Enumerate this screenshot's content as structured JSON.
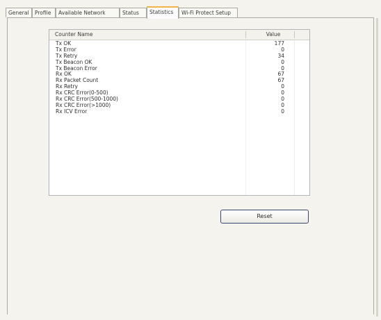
{
  "tabs": [
    {
      "label": "General"
    },
    {
      "label": "Profile"
    },
    {
      "label": "Available Network"
    },
    {
      "label": "Status"
    },
    {
      "label": "Statistics"
    },
    {
      "label": "Wi-Fi Protect Setup"
    }
  ],
  "active_tab": "Statistics",
  "statistics": {
    "columns": {
      "name": "Counter Name",
      "value": "Value"
    },
    "rows": [
      {
        "name": "Tx OK",
        "value": "177"
      },
      {
        "name": "Tx Error",
        "value": "0"
      },
      {
        "name": "Tx Retry",
        "value": "34"
      },
      {
        "name": "Tx Beacon OK",
        "value": "0"
      },
      {
        "name": "Tx Beacon Error",
        "value": "0"
      },
      {
        "name": "Rx OK",
        "value": "67"
      },
      {
        "name": "Rx Packet Count",
        "value": "67"
      },
      {
        "name": "Rx Retry",
        "value": "0"
      },
      {
        "name": "Rx CRC Error(0-500)",
        "value": "0"
      },
      {
        "name": "Rx CRC Error(500-1000)",
        "value": "0"
      },
      {
        "name": "Rx CRC Error(>1000)",
        "value": "0"
      },
      {
        "name": "Rx ICV Error",
        "value": "0"
      }
    ]
  },
  "reset_button": {
    "label": "Reset"
  }
}
